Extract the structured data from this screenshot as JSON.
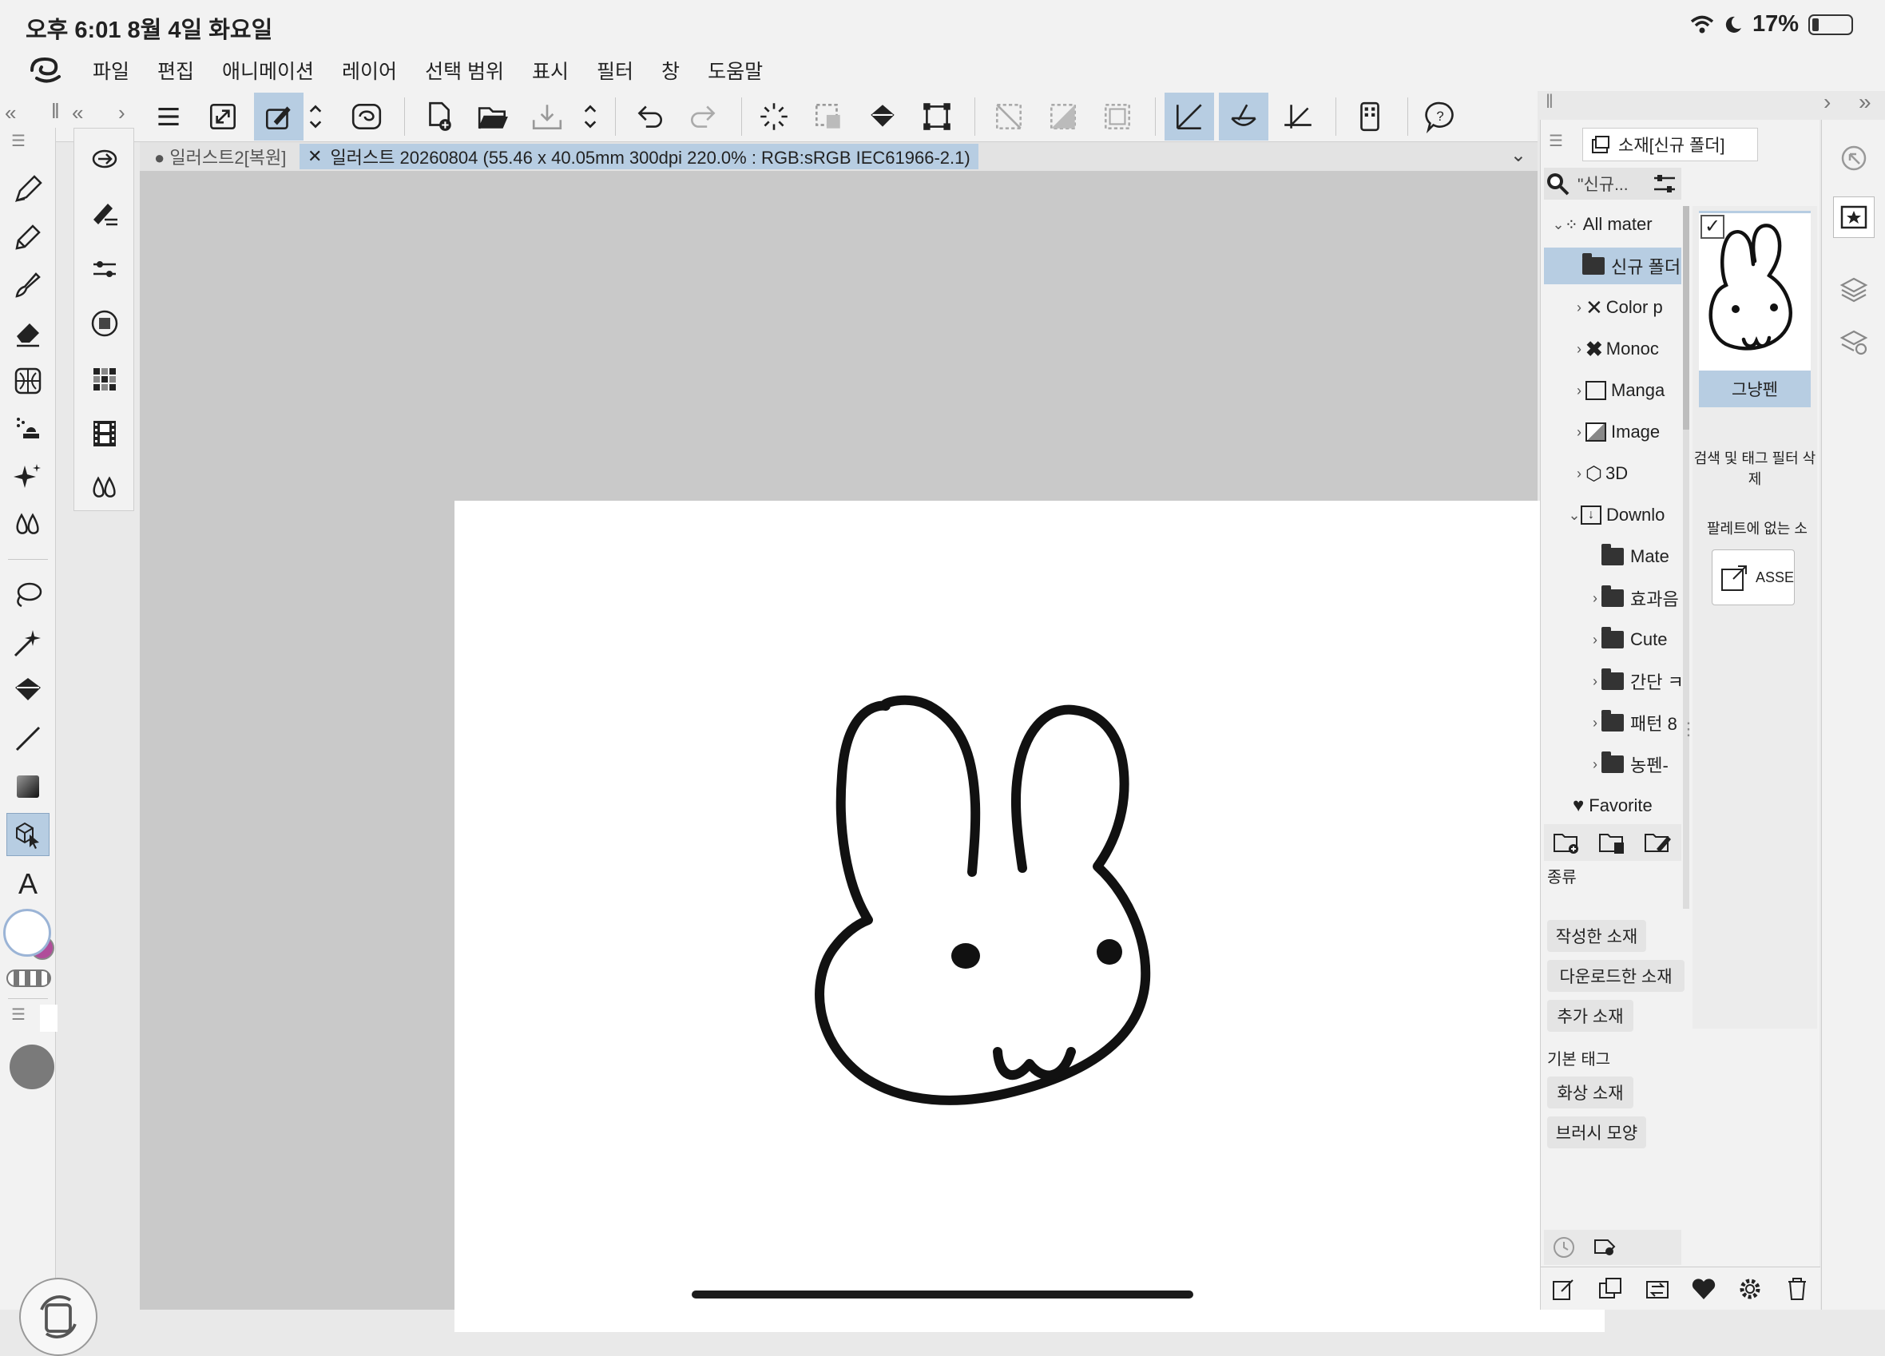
{
  "status": {
    "time": "오후 6:01   8월 4일 화요일",
    "battery": "17%"
  },
  "menu": [
    "파일",
    "편집",
    "애니메이션",
    "레이어",
    "선택 범위",
    "표시",
    "필터",
    "창",
    "도움말"
  ],
  "tabs": {
    "inactive": "● 일러스트2[복원]",
    "active": "일러스트 20260804 (55.46 x 40.05mm 300dpi 220.0% : RGB:sRGB IEC61966-2.1)"
  },
  "material_panel": {
    "title": "소재[신규 폴더]",
    "search_placeholder": "\"신규...",
    "tree": [
      {
        "label": "All mater",
        "type": "root"
      },
      {
        "label": "신규 폴더",
        "type": "folder",
        "selected": true
      },
      {
        "label": "Color p",
        "type": "color"
      },
      {
        "label": "Monoc",
        "type": "mono"
      },
      {
        "label": "Manga",
        "type": "manga"
      },
      {
        "label": "Image",
        "type": "image"
      },
      {
        "label": "3D",
        "type": "3d"
      },
      {
        "label": "Downlo",
        "type": "download"
      },
      {
        "label": "Mate",
        "type": "folder"
      },
      {
        "label": "효과음",
        "type": "folder"
      },
      {
        "label": "Cute",
        "type": "folder"
      },
      {
        "label": "간단 ㅋ",
        "type": "folder"
      },
      {
        "label": "패턴 8",
        "type": "folder"
      },
      {
        "label": "농펜-",
        "type": "folder"
      },
      {
        "label": "Favorite",
        "type": "favorite"
      }
    ],
    "thumbnail_label": "그냥펜",
    "clear_filter": "검색 및 태그 필터 삭제",
    "not_in_palette": "팔레트에 없는 소",
    "assets_button": "ASSE",
    "kind_label": "종류",
    "kind_tags": [
      "작성한 소재",
      "다운로드한 소재",
      "추가 소재"
    ],
    "basic_tag_label": "기본 태그",
    "basic_tags": [
      "화상 소재",
      "브러시 모양"
    ]
  },
  "colors": {
    "accent": "#b7cde2",
    "main_color": "#ffffff",
    "sub_color": "#b04d9a",
    "canvas_bg": "#c9c9c9",
    "panel_bg": "#f2f2f2"
  }
}
